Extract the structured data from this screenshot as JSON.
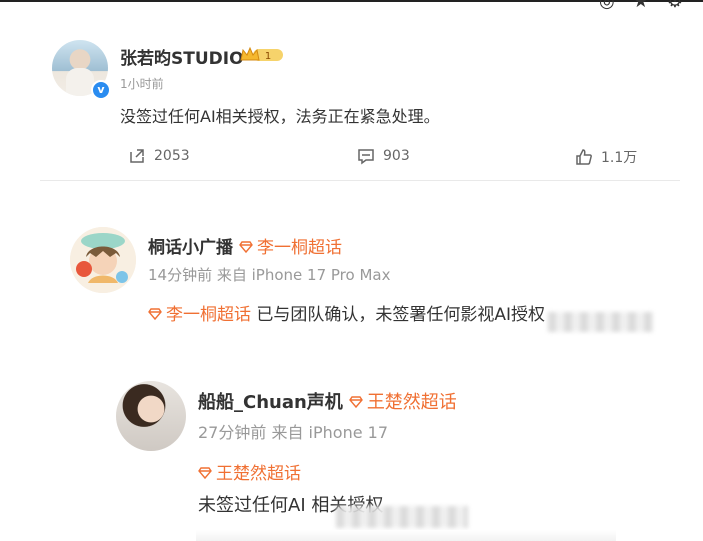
{
  "post": {
    "author": "张若昀STUDIO",
    "verified_icon": "verified-badge-icon",
    "member_icon": "crown-member-icon",
    "member_level": "1",
    "time": "1小时前",
    "text": "没签过任何AI相关授权，法务正在紧急处理。",
    "actions": {
      "repost_count": "2053",
      "comment_count": "903",
      "like_count": "1.1万"
    }
  },
  "comments": [
    {
      "author": "桐话小广播",
      "topic": "李一桐超话",
      "time": "14分钟前",
      "source": "来自 iPhone 17 Pro Max",
      "text_topic": "李一桐超话",
      "text": "已与团队确认，未签署任何影视AI授权"
    },
    {
      "author": "船船_Chuan声机",
      "topic": "王楚然超话",
      "time": "27分钟前",
      "source": "来自 iPhone 17",
      "text_topic": "王楚然超话",
      "text": "未签过任何AI 相关授权"
    }
  ],
  "colors": {
    "accent": "#f07033",
    "verified": "#2a8cf0"
  }
}
